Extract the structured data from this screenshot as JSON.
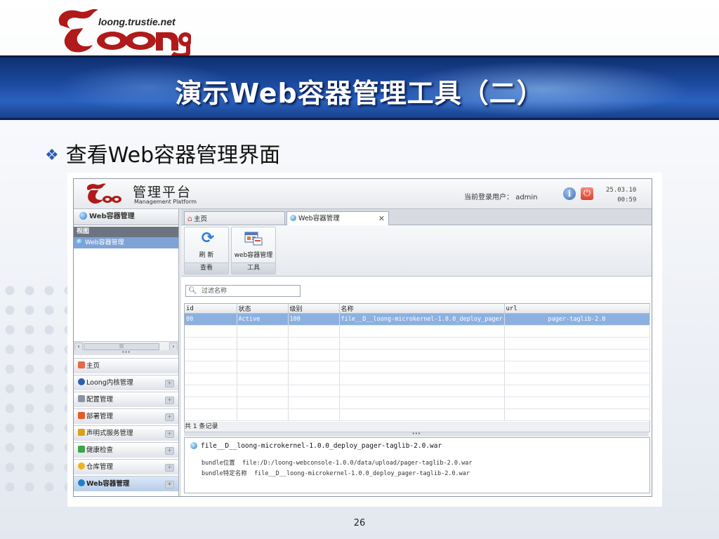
{
  "slide": {
    "logo_url": "loong.trustie.net",
    "title": "演示Web容器管理工具（二）",
    "bullet": "查看Web容器管理界面",
    "page_number": "26",
    "colors": {
      "band": "#1c4aa0",
      "accent": "#2a5bb0"
    }
  },
  "app": {
    "title": "管理平台",
    "subtitle": "Management Platform",
    "user_label": "当前登录用户：",
    "user_name": "admin",
    "date": "25.03.10",
    "time": "00:59",
    "left_panel": {
      "header": "Web容器管理",
      "tree_header": "视图",
      "tree_items": [
        "Web容器管理"
      ],
      "accordion": [
        {
          "label": "主页",
          "icon": "home-icon"
        },
        {
          "label": "Loong内核管理",
          "icon": "globe-icon"
        },
        {
          "label": "配置管理",
          "icon": "wrench-icon"
        },
        {
          "label": "部署管理",
          "icon": "deploy-icon"
        },
        {
          "label": "声明式服务管理",
          "icon": "service-icon"
        },
        {
          "label": "健康检查",
          "icon": "health-icon"
        },
        {
          "label": "仓库管理",
          "icon": "repository-icon"
        },
        {
          "label": "Web容器管理",
          "icon": "globe-icon"
        }
      ]
    },
    "tabs": [
      {
        "label": "主页"
      },
      {
        "label": "Web容器管理",
        "close": "✕"
      }
    ],
    "ribbon": {
      "groups": [
        {
          "button": "刷 新",
          "caption": "查看",
          "icon": "refresh-icon"
        },
        {
          "button": "web容器管理",
          "caption": "工具",
          "icon": "container-icon"
        }
      ]
    },
    "search_placeholder": "过滤名称",
    "grid": {
      "columns": [
        "id",
        "状态",
        "级别",
        "名称",
        "url"
      ],
      "rows": [
        [
          "80",
          "Active",
          "100",
          "file__D__loong-microkernel-1.0.0_deploy_pager-t",
          "pager-taglib-2.0"
        ]
      ],
      "count": "共 1 条记录"
    },
    "detail": {
      "title": "file__D__loong-microkernel-1.0.0_deploy_pager-taglib-2.0.war",
      "rows": [
        {
          "label": "bundle位置",
          "value": "file:/D:/loong-webconsole-1.0.0/data/upload/pager-taglib-2.0.war"
        },
        {
          "label": "bundle特定名称",
          "value": "file__D__loong-microkernel-1.0.0_deploy_pager-taglib-2.0.war"
        }
      ]
    }
  }
}
